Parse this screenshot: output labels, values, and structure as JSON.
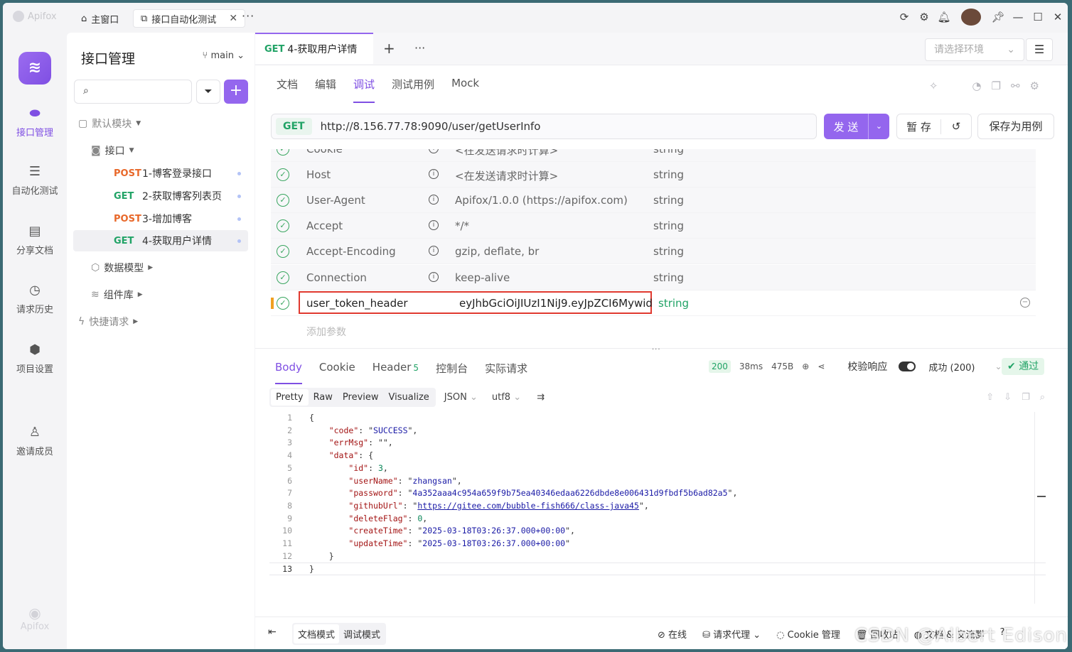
{
  "titlebar": {
    "app_name": "Apifox",
    "tabs": [
      {
        "label": "主窗口",
        "icon": "home-icon"
      },
      {
        "label": "接口自动化测试",
        "icon": "link-icon"
      }
    ],
    "more": "···"
  },
  "rail": {
    "items": [
      {
        "label": "接口管理",
        "icon": "api-icon"
      },
      {
        "label": "自动化测试",
        "icon": "automation-icon"
      },
      {
        "label": "分享文档",
        "icon": "book-icon"
      },
      {
        "label": "请求历史",
        "icon": "clock-icon"
      },
      {
        "label": "项目设置",
        "icon": "settings-icon"
      },
      {
        "label": "邀请成员",
        "icon": "invite-user-icon"
      }
    ],
    "bottom_label": "Apifox"
  },
  "tree": {
    "title": "接口管理",
    "branch": "main",
    "default_module": "默认模块",
    "interfaces_folder": "接口",
    "apis": [
      {
        "method": "POST",
        "name": "1-博客登录接口"
      },
      {
        "method": "GET",
        "name": "2-获取博客列表页"
      },
      {
        "method": "POST",
        "name": "3-增加博客"
      },
      {
        "method": "GET",
        "name": "4-获取用户详情"
      }
    ],
    "data_models": "数据模型",
    "components": "组件库",
    "quick_request": "快捷请求"
  },
  "request": {
    "tab_method": "GET",
    "tab_name": "4-获取用户详情",
    "env_placeholder": "请选择环境",
    "subtabs": [
      "文档",
      "编辑",
      "调试",
      "测试用例",
      "Mock"
    ],
    "method": "GET",
    "url": "http://8.156.77.78:9090/user/getUserInfo",
    "send": "发 送",
    "stash": "暂 存",
    "save_as_case": "保存为用例",
    "headers": [
      {
        "key": "Cookie",
        "value": "<在发送请求时计算>",
        "type": "string"
      },
      {
        "key": "Host",
        "value": "<在发送请求时计算>",
        "type": "string"
      },
      {
        "key": "User-Agent",
        "value": "Apifox/1.0.0 (https://apifox.com)",
        "type": "string"
      },
      {
        "key": "Accept",
        "value": "*/*",
        "type": "string"
      },
      {
        "key": "Accept-Encoding",
        "value": "gzip, deflate, br",
        "type": "string"
      },
      {
        "key": "Connection",
        "value": "keep-alive",
        "type": "string"
      }
    ],
    "custom_header": {
      "key": "user_token_header",
      "value": "eyJhbGciOiJIUzI1NiJ9.eyJpZCI6Mywid",
      "type": "string"
    },
    "add_param": "添加参数"
  },
  "response": {
    "tabs": [
      "Body",
      "Cookie",
      "Header",
      "控制台",
      "实际请求"
    ],
    "header_count": "5",
    "status_code": "200",
    "time": "38ms",
    "size": "475B",
    "validate_label": "校验响应",
    "result": "成功 (200)",
    "passed": "通过",
    "formats": [
      "Pretty",
      "Raw",
      "Preview",
      "Visualize"
    ],
    "format_type": "JSON",
    "encoding": "utf8",
    "body": {
      "code": "SUCCESS",
      "errMsg": "",
      "id": "3",
      "userName": "zhangsan",
      "password": "4a352aaa4c954a659f9b75ea40346edaa6226dbde8e006431d9fbdf5b6ad82a5",
      "githubUrl": "https://gitee.com/bubble-fish666/class-java45",
      "deleteFlag": "0",
      "createTime": "2025-03-18T03:26:37.000+00:00",
      "updateTime": "2025-03-18T03:26:37.000+00:00"
    }
  },
  "bottombar": {
    "modes": [
      "文档模式",
      "调试模式"
    ],
    "items": [
      "在线",
      "请求代理",
      "Cookie 管理",
      "回收站",
      "文档 & 交流群"
    ]
  },
  "watermark": "CSDN @Albert Edison"
}
